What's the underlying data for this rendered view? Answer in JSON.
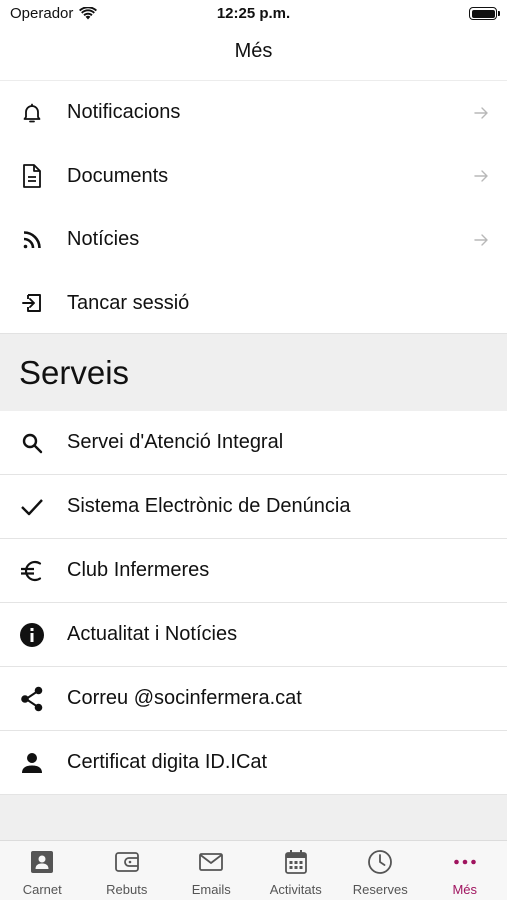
{
  "status_bar": {
    "carrier": "Operador",
    "time": "12:25 p.m."
  },
  "nav": {
    "title": "Més"
  },
  "menu": {
    "items": [
      {
        "label": "Notificacions",
        "icon": "bell-icon",
        "has_arrow": true
      },
      {
        "label": "Documents",
        "icon": "document-icon",
        "has_arrow": true
      },
      {
        "label": "Notícies",
        "icon": "rss-icon",
        "has_arrow": true
      },
      {
        "label": "Tancar sessió",
        "icon": "logout-icon",
        "has_arrow": false
      }
    ]
  },
  "services": {
    "title": "Serveis",
    "items": [
      {
        "label": "Servei d'Atenció Integral",
        "icon": "search-icon"
      },
      {
        "label": "Sistema Electrònic de Denúncia",
        "icon": "check-icon"
      },
      {
        "label": "Club Infermeres",
        "icon": "euro-icon"
      },
      {
        "label": "Actualitat i Notícies",
        "icon": "info-icon"
      },
      {
        "label": "Correu @socinfermera.cat",
        "icon": "share-icon"
      },
      {
        "label": "Certificat digita ID.ICat",
        "icon": "person-icon"
      }
    ]
  },
  "tab_bar": {
    "tabs": [
      {
        "label": "Carnet",
        "icon": "id-card-icon",
        "active": false
      },
      {
        "label": "Rebuts",
        "icon": "wallet-icon",
        "active": false
      },
      {
        "label": "Emails",
        "icon": "mail-icon",
        "active": false
      },
      {
        "label": "Activitats",
        "icon": "calendar-icon",
        "active": false
      },
      {
        "label": "Reserves",
        "icon": "clock-icon",
        "active": false
      },
      {
        "label": "Més",
        "icon": "more-dots-icon",
        "active": true
      }
    ],
    "active_color": "#a0145f"
  }
}
